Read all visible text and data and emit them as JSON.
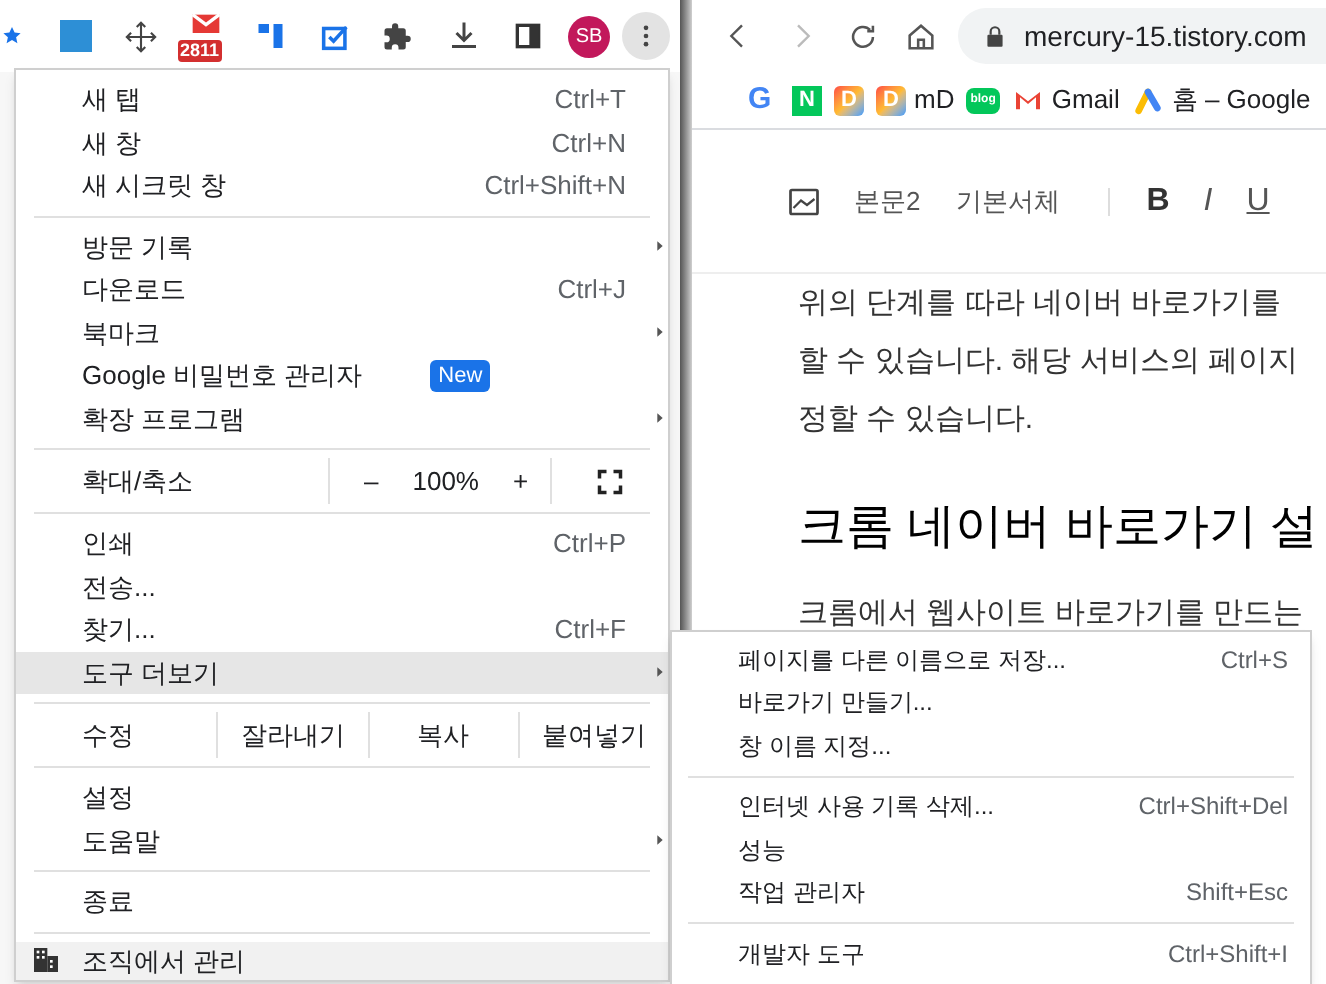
{
  "browser_toolbar": {
    "mail_badge": "2811",
    "profile_initials": "SB"
  },
  "menu": {
    "items": [
      {
        "kind": "item",
        "label": "새 탭",
        "shortcut": "Ctrl+T",
        "submenu": false,
        "selected": false
      },
      {
        "kind": "item",
        "label": "새 창",
        "shortcut": "Ctrl+N",
        "submenu": false,
        "selected": false
      },
      {
        "kind": "item",
        "label": "새 시크릿 창",
        "shortcut": "Ctrl+Shift+N",
        "submenu": false,
        "selected": false
      },
      {
        "kind": "separator"
      },
      {
        "kind": "item",
        "label": "방문 기록",
        "submenu": true,
        "selected": false
      },
      {
        "kind": "item",
        "label": "다운로드",
        "shortcut": "Ctrl+J",
        "submenu": false,
        "selected": false
      },
      {
        "kind": "item",
        "label": "북마크",
        "submenu": true,
        "selected": false
      },
      {
        "kind": "item",
        "label": "Google 비밀번호 관리자",
        "badge": "New",
        "submenu": false,
        "selected": false
      },
      {
        "kind": "item",
        "label": "확장 프로그램",
        "submenu": true,
        "selected": false
      },
      {
        "kind": "separator"
      },
      {
        "kind": "zoom",
        "label": "확대/축소",
        "minus": "–",
        "value": "100%",
        "plus": "+"
      },
      {
        "kind": "separator"
      },
      {
        "kind": "item",
        "label": "인쇄",
        "shortcut": "Ctrl+P",
        "submenu": false,
        "selected": false
      },
      {
        "kind": "item",
        "label": "전송...",
        "submenu": false,
        "selected": false
      },
      {
        "kind": "item",
        "label": "찾기...",
        "shortcut": "Ctrl+F",
        "submenu": false,
        "selected": false
      },
      {
        "kind": "item",
        "label": "도구 더보기",
        "submenu": true,
        "selected": true
      },
      {
        "kind": "separator"
      },
      {
        "kind": "edit",
        "label": "수정",
        "buttons": [
          "잘라내기",
          "복사",
          "붙여넣기"
        ]
      },
      {
        "kind": "separator"
      },
      {
        "kind": "item",
        "label": "설정",
        "submenu": false,
        "selected": false
      },
      {
        "kind": "item",
        "label": "도움말",
        "submenu": true,
        "selected": false
      },
      {
        "kind": "separator"
      },
      {
        "kind": "item",
        "label": "종료",
        "submenu": false,
        "selected": false
      },
      {
        "kind": "separator"
      },
      {
        "kind": "managed",
        "label": "조직에서 관리"
      }
    ]
  },
  "submenu": {
    "items": [
      {
        "kind": "item",
        "label": "페이지를 다른 이름으로 저장...",
        "shortcut": "Ctrl+S"
      },
      {
        "kind": "item",
        "label": "바로가기 만들기..."
      },
      {
        "kind": "item",
        "label": "창 이름 지정..."
      },
      {
        "kind": "separator"
      },
      {
        "kind": "item",
        "label": "인터넷 사용 기록 삭제...",
        "shortcut": "Ctrl+Shift+Del"
      },
      {
        "kind": "item",
        "label": "성능"
      },
      {
        "kind": "item",
        "label": "작업 관리자",
        "shortcut": "Shift+Esc"
      },
      {
        "kind": "separator"
      },
      {
        "kind": "item",
        "label": "개발자 도구",
        "shortcut": "Ctrl+Shift+I"
      }
    ]
  },
  "right_window": {
    "url": "mercury-15.tistory.com",
    "bookmarks": [
      {
        "kind": "google",
        "mark": "G"
      },
      {
        "kind": "naver",
        "mark": "N"
      },
      {
        "kind": "d",
        "mark": "D"
      },
      {
        "kind": "d",
        "mark": "D",
        "label": "mD"
      },
      {
        "kind": "blog",
        "mark": "blog"
      },
      {
        "kind": "gmail",
        "label": "Gmail"
      },
      {
        "kind": "ads",
        "label": "홈 – Google"
      }
    ],
    "editor_toolbar": {
      "paragraph_style": "본문2",
      "font": "기본서체",
      "format_buttons": [
        "B",
        "I",
        "U"
      ]
    },
    "content": [
      {
        "kind": "paragraph",
        "text": "위의 단계를 따라 네이버 바로가기를"
      },
      {
        "kind": "paragraph",
        "text": "할 수 있습니다. 해당 서비스의 페이지"
      },
      {
        "kind": "paragraph",
        "text": "정할 수 있습니다."
      },
      {
        "kind": "heading",
        "text": "크롬 네이버 바로가기 설"
      },
      {
        "kind": "paragraph",
        "text": "크롬에서 웹사이트 바로가기를 만드는"
      }
    ]
  }
}
